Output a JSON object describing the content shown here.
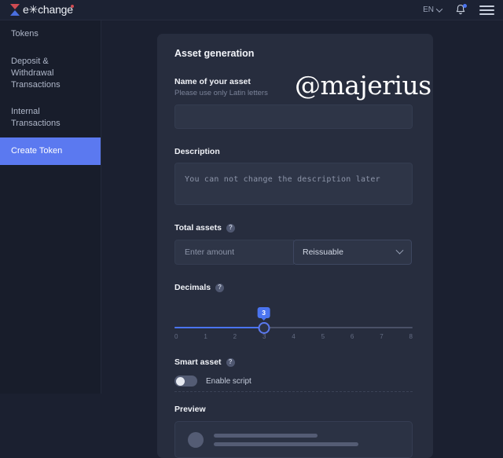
{
  "topbar": {
    "brand_text": "e✳change",
    "brand_icon": "hourglass-logo-icon",
    "language": "EN",
    "language_chevron": "chevron-down-icon",
    "notifications_icon": "bell-icon",
    "menu_icon": "hamburger-menu-icon"
  },
  "sidebar": {
    "items": [
      {
        "label": "Tokens",
        "active": false
      },
      {
        "label": "Deposit & Withdrawal Transactions",
        "active": false
      },
      {
        "label": "Internal Transactions",
        "active": false
      },
      {
        "label": "Create Token",
        "active": true
      }
    ]
  },
  "watermark": "@majerius",
  "card": {
    "title": "Asset generation",
    "name_field": {
      "label": "Name of your asset",
      "hint": "Please use only Latin letters",
      "value": "",
      "placeholder": ""
    },
    "description_field": {
      "label": "Description",
      "value": "",
      "placeholder": "You can not change the description later"
    },
    "total_assets": {
      "label": "Total assets",
      "help_icon": "help-circle-icon",
      "amount_placeholder": "Enter amount",
      "amount_value": "",
      "reissuable_selected": "Reissuable",
      "reissuable_chevron": "chevron-down-icon"
    },
    "decimals": {
      "label": "Decimals",
      "help_icon": "help-circle-icon",
      "value": 3,
      "min": 0,
      "max": 8,
      "ticks": [
        "0",
        "1",
        "2",
        "3",
        "4",
        "5",
        "6",
        "7",
        "8"
      ]
    },
    "smart_asset": {
      "label": "Smart asset",
      "help_icon": "help-circle-icon",
      "toggle_label": "Enable script",
      "toggle_on": false
    },
    "preview": {
      "label": "Preview",
      "avatar_icon": "avatar-placeholder-icon"
    }
  },
  "colors": {
    "page_bg": "#1b2030",
    "sidebar_bg": "#181d2b",
    "card_bg": "#272d3e",
    "accent": "#5b79f0",
    "slider_accent": "#4a74f0",
    "logo_red": "#cf4b52",
    "logo_blue": "#4a6fe0"
  }
}
